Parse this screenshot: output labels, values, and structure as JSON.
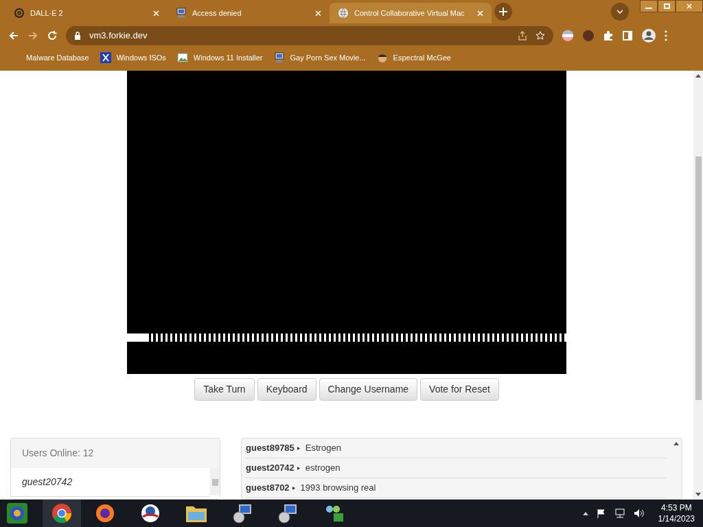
{
  "browser": {
    "tabs": [
      {
        "title": "DALL·E 2",
        "selected": false
      },
      {
        "title": "Access denied",
        "selected": false
      },
      {
        "title": "Control Collaborative Virtual Mac",
        "selected": true
      }
    ],
    "url": "vm3.forkie.dev",
    "bookmarks": [
      "Malware Database",
      "Windows ISOs",
      "Windows 11 Installer",
      "Gay Porn Sex Movie...",
      "Espectral McGee"
    ]
  },
  "vm_screen": {
    "boot_progress": {
      "level": 0.05
    }
  },
  "buttons": [
    "Take Turn",
    "Keyboard",
    "Change Username",
    "Vote for Reset"
  ],
  "users_panel": {
    "heading": "Users Online: 12",
    "users": [
      "guest20742"
    ]
  },
  "chat": [
    {
      "user": "guest89785",
      "message": "Estrogen"
    },
    {
      "user": "guest20742",
      "message": "estrogen"
    },
    {
      "user": "guest8702",
      "message": "1993 browsing real"
    }
  ],
  "taskbar": {
    "time": "4:53 PM",
    "date": "1/14/2023"
  }
}
